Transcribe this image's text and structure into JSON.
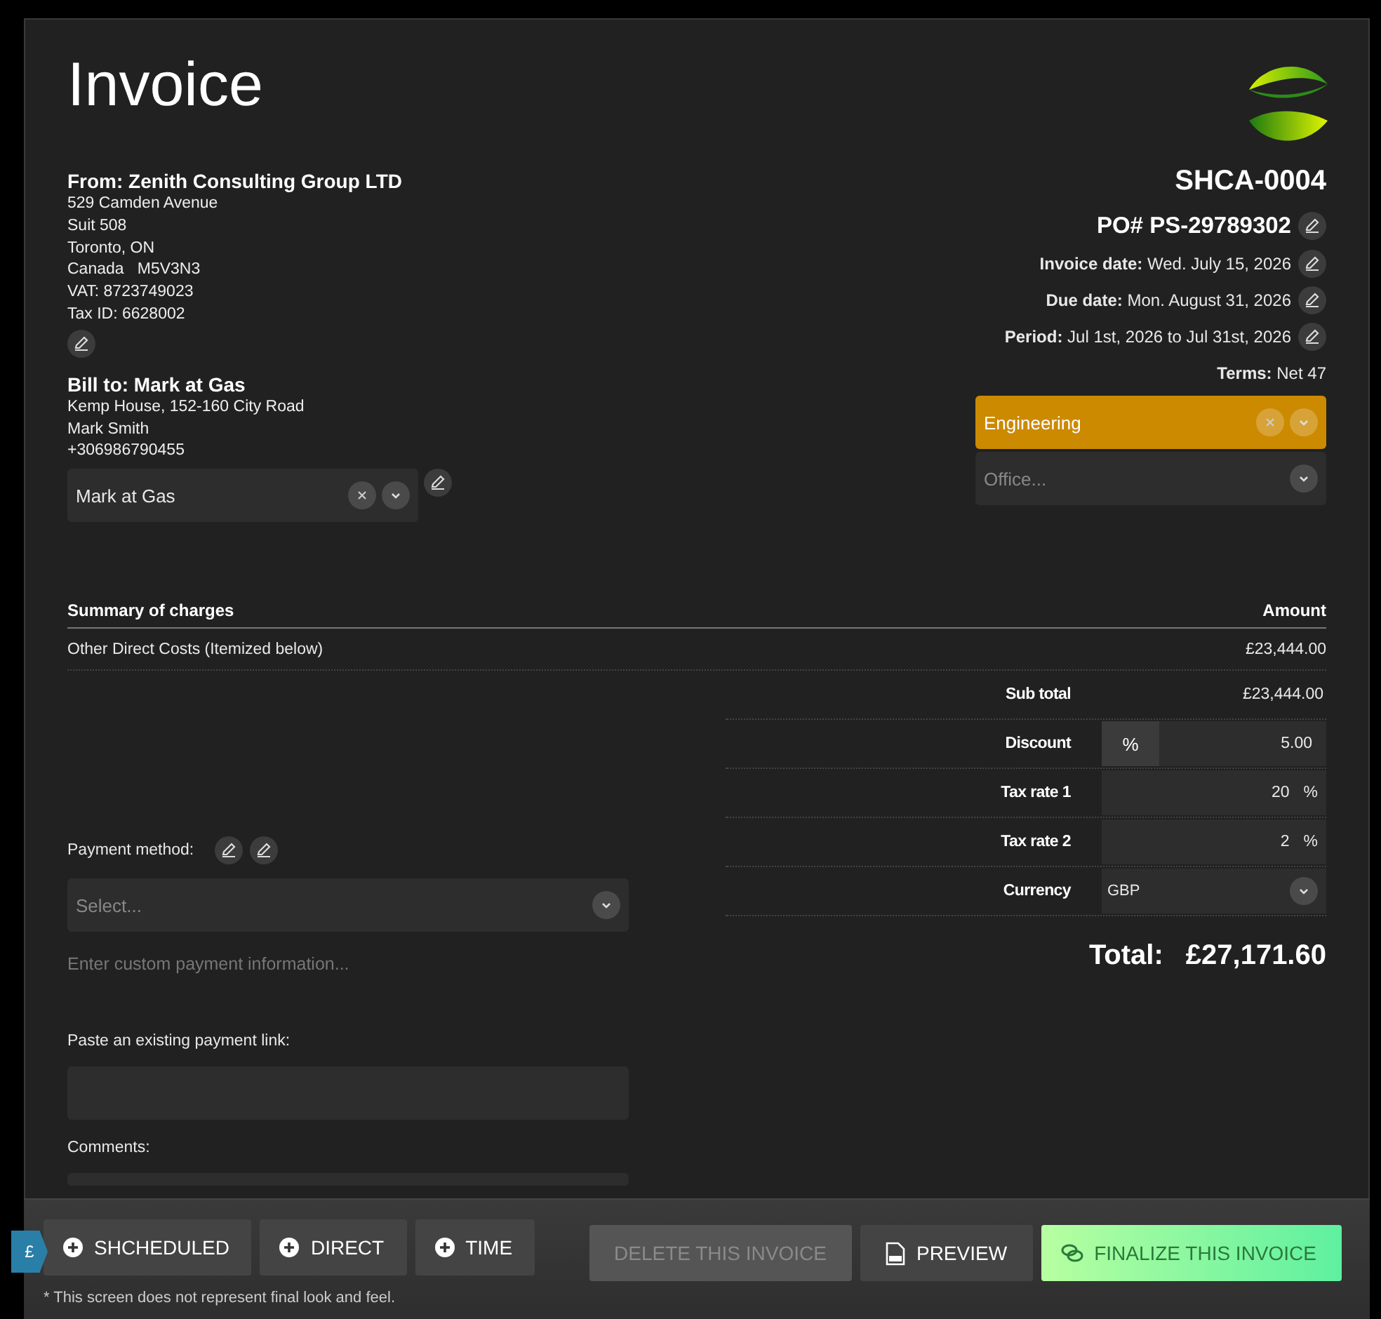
{
  "title": "Invoice",
  "from": {
    "heading": "From: Zenith Consulting Group LTD",
    "lines": [
      "529 Camden Avenue",
      "Suit 508",
      "Toronto, ON",
      "Canada   M5V3N3",
      "VAT: 8723749023",
      "Tax ID: 6628002"
    ]
  },
  "bill_to": {
    "heading": "Bill to: Mark at Gas",
    "lines": [
      "Kemp House, 152-160 City Road",
      "Mark Smith",
      "+306986790455"
    ],
    "client_select": {
      "value": "Mark at Gas"
    }
  },
  "invoice_number": "SHCA-0004",
  "po": "PO# PS-29789302",
  "details": [
    {
      "text": "**Invoice date:** Wed. July 15, 2026",
      "editable": true
    },
    {
      "text": "**Due date:** Mon. August 31, 2026",
      "editable": true
    },
    {
      "text": "**Period:** Jul 1st, 2026 to Jul 31st, 2026",
      "editable": true
    },
    {
      "text": "**Terms:** Net 47",
      "editable": false
    }
  ],
  "department_select": {
    "value": "Engineering"
  },
  "office_select": {
    "placeholder": "Office..."
  },
  "summary": {
    "columns": [
      "Summary of charges",
      "Amount"
    ],
    "rows": [
      {
        "description": "Other Direct Costs (Itemized below)",
        "amount": "£23,444.00"
      }
    ]
  },
  "totals": [
    {
      "kind": "text",
      "label": "Sub total",
      "value": "£23,444.00"
    },
    {
      "kind": "discount",
      "label": "Discount",
      "unit": "%",
      "value": "5.00"
    },
    {
      "kind": "percent",
      "label": "Tax rate 1",
      "value": "20",
      "unit": "%"
    },
    {
      "kind": "percent",
      "label": "Tax rate 2",
      "value": "2",
      "unit": "%"
    },
    {
      "kind": "select",
      "label": "Currency",
      "value": "GBP"
    }
  ],
  "total": {
    "label": "Total:",
    "value": "£27,171.60"
  },
  "payment": {
    "label": "Payment method:",
    "select_placeholder": "Select...",
    "custom_placeholder": "Enter custom payment information...",
    "link_label": "Paste an existing payment link:",
    "comments_label": "Comments:"
  },
  "currency_tab": "£",
  "add_buttons": [
    "SHCHEDULED",
    "DIRECT",
    "TIME"
  ],
  "actions": [
    {
      "kind": "delete",
      "label": "DELETE THIS INVOICE",
      "disabled": true
    },
    {
      "kind": "preview",
      "label": "PREVIEW",
      "disabled": false
    },
    {
      "kind": "finalize",
      "label": "FINALIZE THIS INVOICE",
      "disabled": false
    }
  ],
  "footnote": "* This screen does not represent final look and feel."
}
